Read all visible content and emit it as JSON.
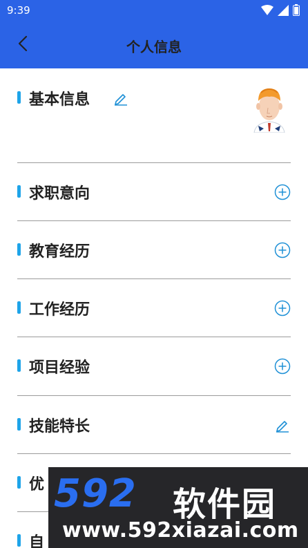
{
  "status_bar": {
    "time": "9:39"
  },
  "header": {
    "title": "个人信息",
    "back_icon": "chevron-left-icon"
  },
  "sections": [
    {
      "label": "基本信息",
      "action_icon": "pencil-icon"
    },
    {
      "label": "求职意向",
      "action_icon": "plus-circle-icon"
    },
    {
      "label": "教育经历",
      "action_icon": "plus-circle-icon"
    },
    {
      "label": "工作经历",
      "action_icon": "plus-circle-icon"
    },
    {
      "label": "项目经验",
      "action_icon": "plus-circle-icon"
    },
    {
      "label": "技能特长",
      "action_icon": "pencil-icon"
    },
    {
      "label": "优",
      "action_icon": ""
    },
    {
      "label": "自",
      "action_icon": ""
    }
  ],
  "watermark": {
    "logo": "592",
    "brand": "软件园",
    "url": "www.592xiazai.com"
  },
  "colors": {
    "header": "#2b63e6",
    "accent": "#1ea4e9",
    "icon": "#1e90d6"
  }
}
